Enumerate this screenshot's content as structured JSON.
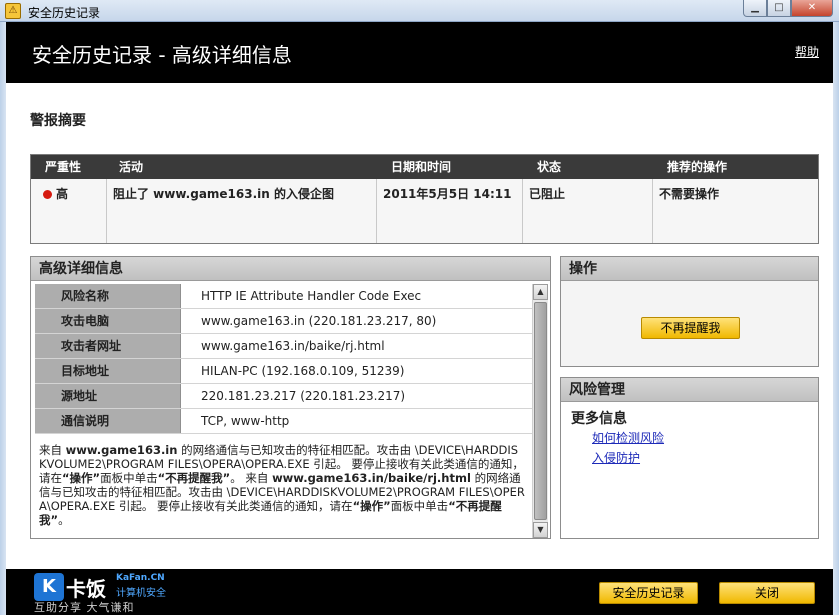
{
  "window": {
    "title": "安全历史记录",
    "app_icon": "shield-icon",
    "controls": [
      "minimize-icon",
      "maximize-icon",
      "close-icon"
    ]
  },
  "header": {
    "title": "安全历史记录 - 高级详细信息",
    "help_label": "帮助"
  },
  "alert_summary": {
    "title": "警报摘要",
    "columns": [
      "严重性",
      "活动",
      "日期和时间",
      "状态",
      "推荐的操作"
    ],
    "row": {
      "severity": "高",
      "severity_color": "#d61a10",
      "activity": "阻止了 www.game163.in 的入侵企图",
      "datetime": "2011年5月5日 14:11",
      "status": "已阻止",
      "recommended": "不需要操作"
    }
  },
  "details": {
    "title": "高级详细信息",
    "rows": [
      {
        "key": "风险名称",
        "value": "HTTP IE Attribute Handler Code Exec"
      },
      {
        "key": "攻击电脑",
        "value": "www.game163.in (220.181.23.217, 80)"
      },
      {
        "key": "攻击者网址",
        "value": "www.game163.in/baike/rj.html"
      },
      {
        "key": "目标地址",
        "value": "HILAN-PC (192.168.0.109, 51239)"
      },
      {
        "key": "源地址",
        "value": "220.181.23.217 (220.181.23.217)"
      },
      {
        "key": "通信说明",
        "value": "TCP, www-http"
      }
    ],
    "description": {
      "p1_prefix": "来自 ",
      "p1_host": "www.game163.in",
      "p1_mid": " 的网络通信与已知攻击的特征相匹配。攻击由 \\DEVICE\\HARDDISKVOLUME2\\PROGRAM FILES\\OPERA\\OPERA.EXE 引起。 要停止接收有关此类通信的通知，请在",
      "p1_ops": "“操作”",
      "p1_panel": "面板中单击",
      "p1_stop": "“不再提醒我”",
      "p1_end": "。 来自 ",
      "p2_host": "www.game163.in/baike/rj.html",
      "p2_mid": " 的网络通信与已知攻击的特征相匹配。攻击由 \\DEVICE\\HARDDISKVOLUME2\\PROGRAM FILES\\OPERA\\OPERA.EXE 引起。 要停止接收有关此类通信的通知，请在",
      "p2_ops": "“操作”",
      "p2_panel": "面板中单击",
      "p2_stop": "“不再提醒我”",
      "p2_end": "。"
    }
  },
  "operations": {
    "title": "操作",
    "stop_button": "不再提醒我"
  },
  "risk_management": {
    "title": "风险管理",
    "more_info": "更多信息",
    "links": [
      "如何检测风险",
      "入侵防护"
    ]
  },
  "footer": {
    "brand_logo": "K",
    "brand_name": "卡饭",
    "brand_site": "KaFan.CN",
    "brand_sub": "计算机安全",
    "brand_tag": "互助分享 大气谦和",
    "history_button": "安全历史记录",
    "close_button": "关闭"
  }
}
